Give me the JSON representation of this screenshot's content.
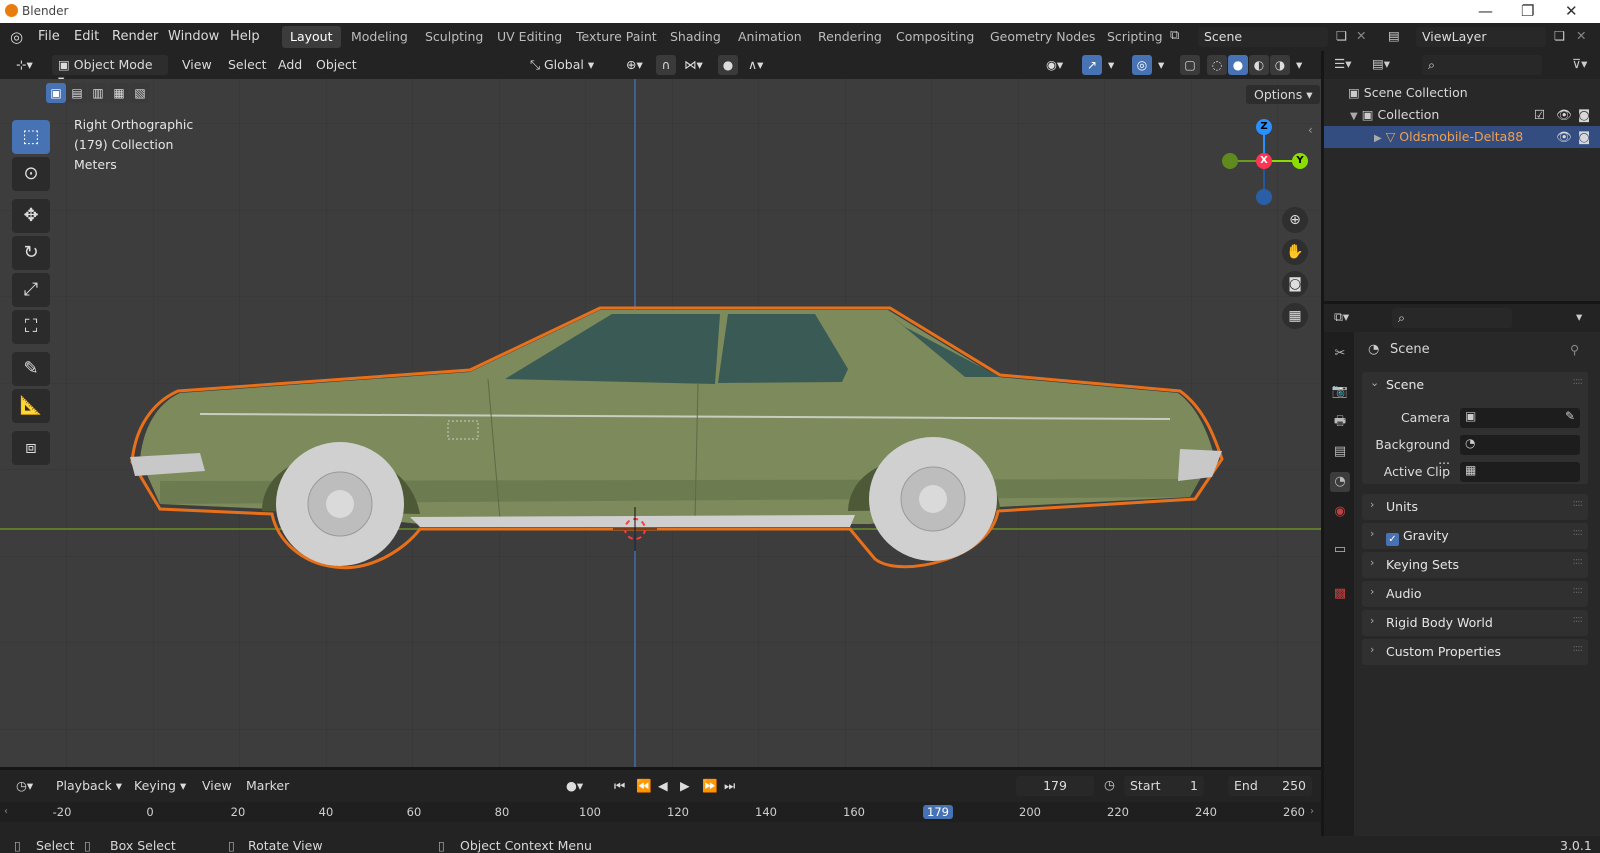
{
  "window": {
    "title": "Blender",
    "minimize": "—",
    "maximize": "❐",
    "close": "✕"
  },
  "menu": {
    "items": [
      "File",
      "Edit",
      "Render",
      "Window",
      "Help"
    ]
  },
  "workspaces": [
    "Layout",
    "Modeling",
    "Sculpting",
    "UV Editing",
    "Texture Paint",
    "Shading",
    "Animation",
    "Rendering",
    "Compositing",
    "Geometry Nodes",
    "Scripting"
  ],
  "active_workspace": "Layout",
  "scene_field": "Scene",
  "viewlayer_field": "ViewLayer",
  "viewport_header": {
    "mode": "Object Mode",
    "menus": [
      "View",
      "Select",
      "Add",
      "Object"
    ],
    "transform_orientation": "Global",
    "options_label": "Options"
  },
  "viewport_info": {
    "view": "Right Orthographic",
    "collection": "(179) Collection",
    "units": "Meters"
  },
  "gizmo": {
    "z": "Z",
    "x": "X",
    "y": "Y"
  },
  "colors": {
    "accent_blue": "#4772b3",
    "selection_orange": "#e8701a",
    "car_body": "#7c8a5c",
    "axis_red": "#ff3352",
    "axis_green": "#8bdc00",
    "axis_blue": "#2890ff"
  },
  "outliner": {
    "root": "Scene Collection",
    "collection": "Collection",
    "object": "Oldsmobile-Delta88"
  },
  "properties": {
    "context_title": "Scene",
    "panel_scene": "Scene",
    "camera_label": "Camera",
    "background_label": "Background ...",
    "active_clip_label": "Active Clip",
    "panels": [
      "Units",
      "Gravity",
      "Keying Sets",
      "Audio",
      "Rigid Body World",
      "Custom Properties"
    ]
  },
  "timeline": {
    "menus": [
      "Playback",
      "Keying",
      "View",
      "Marker"
    ],
    "current_frame": "179",
    "start_label": "Start",
    "start_value": "1",
    "end_label": "End",
    "end_value": "250",
    "ticks": [
      "-20",
      "0",
      "20",
      "40",
      "60",
      "80",
      "100",
      "120",
      "140",
      "160",
      "179",
      "200",
      "220",
      "240",
      "260"
    ]
  },
  "statusbar": {
    "select": "Select",
    "box_select": "Box Select",
    "rotate_view": "Rotate View",
    "context_menu": "Object Context Menu",
    "version": "3.0.1"
  }
}
